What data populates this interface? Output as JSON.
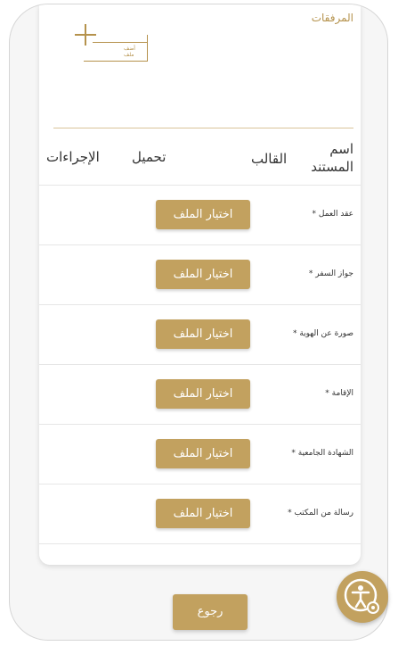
{
  "attachments": {
    "title": "المرفقات",
    "add_file_label": "أضف ملف"
  },
  "table": {
    "headers": {
      "name": "اسم المستند",
      "template": "القالب",
      "upload": "تحميل",
      "actions": "الإجراءات"
    },
    "rows": [
      {
        "label": "* عقد العمل",
        "button": "اختيار الملف"
      },
      {
        "label": "* جواز السفر",
        "button": "اختيار الملف"
      },
      {
        "label": "* صورة عن الهوية",
        "button": "اختيار الملف"
      },
      {
        "label": "* الإقامة",
        "button": "اختيار الملف"
      },
      {
        "label": "* الشهادة الجامعية",
        "button": "اختيار الملف"
      },
      {
        "label": "* رسالة من المكتب",
        "button": "اختيار الملف"
      }
    ]
  },
  "footer": {
    "back_label": "رجوع"
  },
  "accessibility": {
    "icon": "accessibility-settings-icon"
  },
  "colors": {
    "accent": "#c2a15f",
    "title": "#b5924c"
  }
}
